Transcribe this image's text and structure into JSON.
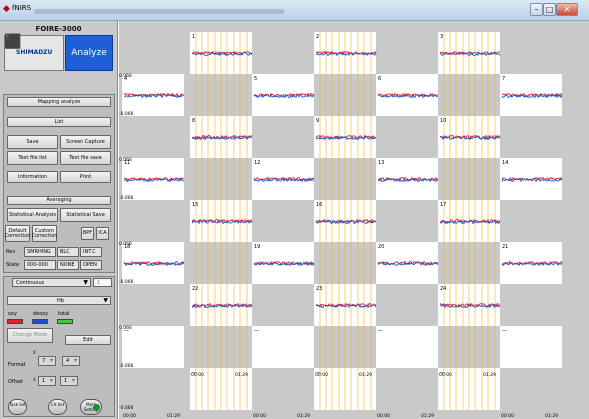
{
  "window": {
    "app_name": "fNIRS",
    "close_clip": "Co",
    "controls": {
      "minimize": "–",
      "maximize": "□",
      "close": "✕"
    }
  },
  "brand": {
    "model": "FOIRE-3000",
    "logo": "SHIMADZU",
    "analyze_label": "Analyze"
  },
  "buttons": {
    "mapping_analyze": "Mapping analyze",
    "list": "List",
    "save": "Save",
    "screen_capture": "Screen Capture",
    "text_file_list": "Text file list",
    "text_file_save": "Text file save",
    "information": "Information",
    "print": "Print",
    "averaging": "Averaging",
    "statistical_analysis": "Statistical Analysis",
    "statistical_save": "Statistical Save",
    "default_correction": "Default Correction",
    "custom_correction": "Custom Correction",
    "bpf": "BPF",
    "ica": "ICA",
    "change_mode": "Change Mode",
    "edit": "Edit"
  },
  "status_table": {
    "row1_label": "Rev",
    "row2_label": "State",
    "headers": [
      "SMRHING",
      "BLC",
      "INT.C"
    ],
    "values": [
      "000-000",
      "NONE",
      "OPEN"
    ]
  },
  "mode": {
    "value": "Continuous",
    "number": "1",
    "channel_type": "Hb"
  },
  "legend": [
    {
      "label": "oxy",
      "color": "#e8202a"
    },
    {
      "label": "deoxy",
      "color": "#1b56c8"
    },
    {
      "label": "total",
      "color": "#3fcc3f"
    }
  ],
  "format": {
    "label": "Format",
    "x_label": "X",
    "x_value": "7",
    "y_value": "4"
  },
  "offset": {
    "label": "Offset",
    "x_label": "X",
    "x_value": "1",
    "y_value": "1"
  },
  "bottom_buttons": [
    {
      "label": "Task Set"
    },
    {
      "label": "CH Set"
    },
    {
      "label": "Mark Setting"
    }
  ],
  "plot": {
    "y_max_label": "0.066",
    "y_min_label": "-0.066",
    "time_start": "00:00",
    "time_end": "01:29",
    "channels": [
      "1",
      "2",
      "3",
      "4",
      "5",
      "6",
      "7",
      "8",
      "9",
      "10",
      "11",
      "12",
      "13",
      "14",
      "15",
      "16",
      "17",
      "18",
      "19",
      "20",
      "21",
      "22",
      "23",
      "24"
    ],
    "empty_cells": [
      "—",
      "—",
      "—",
      "—",
      "—",
      "—",
      "—"
    ],
    "colors": {
      "oxy": "#e8202a",
      "deoxy": "#1b56c8",
      "marker": "#f2b21c",
      "background": "#ffffff",
      "blank": "#c9c9c9"
    }
  }
}
